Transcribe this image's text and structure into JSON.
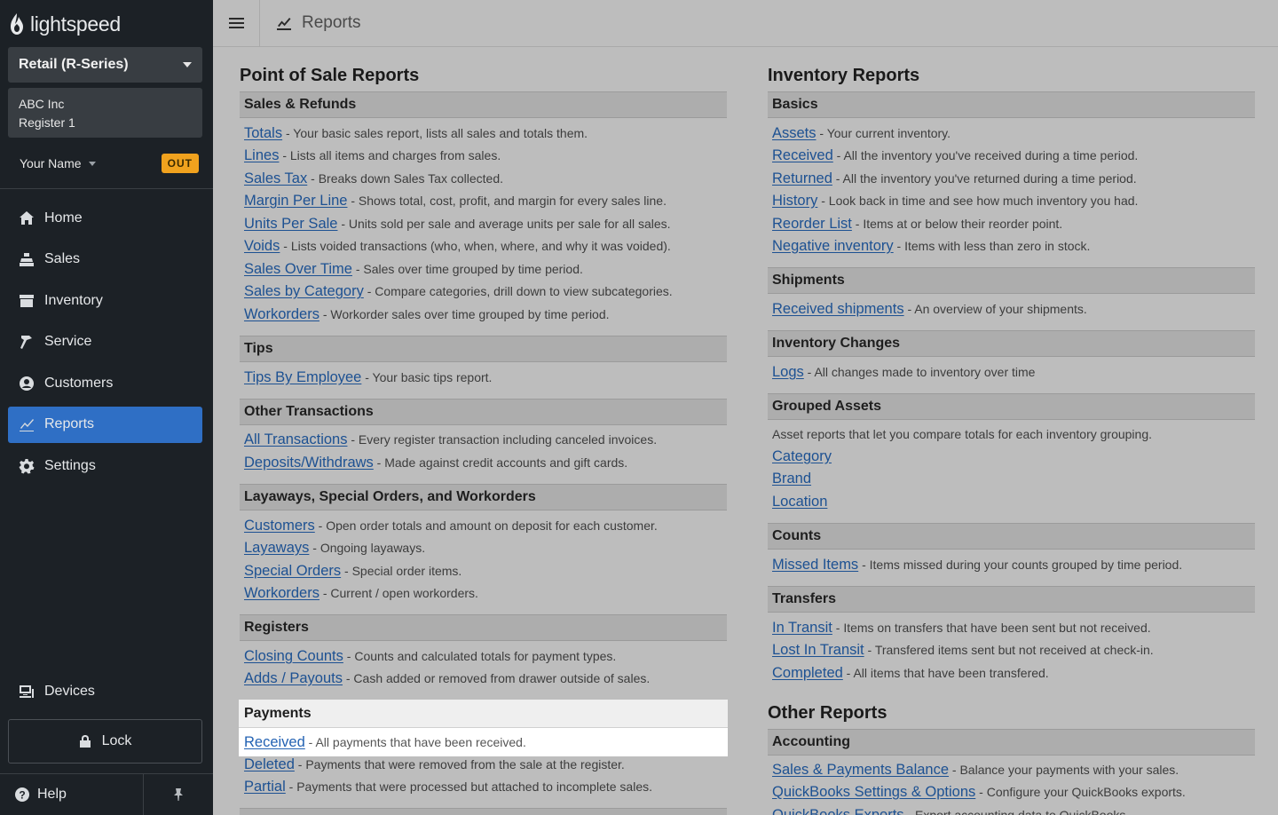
{
  "sidebar": {
    "logo_text": "lightspeed",
    "store": "Retail (R-Series)",
    "company": "ABC Inc",
    "register": "Register 1",
    "user_name": "Your Name",
    "out_badge": "OUT",
    "nav": [
      {
        "label": "Home",
        "icon": "home-icon"
      },
      {
        "label": "Sales",
        "icon": "sales-icon"
      },
      {
        "label": "Inventory",
        "icon": "inventory-icon"
      },
      {
        "label": "Service",
        "icon": "service-icon"
      },
      {
        "label": "Customers",
        "icon": "customers-icon"
      },
      {
        "label": "Reports",
        "icon": "reports-icon",
        "active": true
      },
      {
        "label": "Settings",
        "icon": "settings-icon"
      }
    ],
    "devices": "Devices",
    "lock": "Lock",
    "help": "Help"
  },
  "header": {
    "title": "Reports"
  },
  "pos": {
    "title": "Point of Sale Reports",
    "sales_refunds": {
      "heading": "Sales & Refunds",
      "items": [
        {
          "link": "Totals",
          "desc": " - Your basic sales report, lists all sales and totals them."
        },
        {
          "link": "Lines",
          "desc": " - Lists all items and charges from sales."
        },
        {
          "link": "Sales Tax",
          "desc": " - Breaks down Sales Tax collected."
        },
        {
          "link": "Margin Per Line",
          "desc": " - Shows total, cost, profit, and margin for every sales line."
        },
        {
          "link": "Units Per Sale",
          "desc": " - Units sold per sale and average units per sale for all sales."
        },
        {
          "link": "Voids",
          "desc": " - Lists voided transactions (who, when, where, and why it was voided)."
        },
        {
          "link": "Sales Over Time",
          "desc": " - Sales over time grouped by time period."
        },
        {
          "link": "Sales by Category",
          "desc": " - Compare categories, drill down to view subcategories."
        },
        {
          "link": "Workorders",
          "desc": " - Workorder sales over time grouped by time period."
        }
      ]
    },
    "tips": {
      "heading": "Tips",
      "items": [
        {
          "link": "Tips By Employee",
          "desc": " - Your basic tips report."
        }
      ]
    },
    "other": {
      "heading": "Other Transactions",
      "items": [
        {
          "link": "All Transactions",
          "desc": " - Every register transaction including canceled invoices."
        },
        {
          "link": "Deposits/Withdraws",
          "desc": " - Made against credit accounts and gift cards."
        }
      ]
    },
    "layaways": {
      "heading": "Layaways, Special Orders, and Workorders",
      "items": [
        {
          "link": "Customers",
          "desc": " - Open order totals and amount on deposit for each customer."
        },
        {
          "link": "Layaways",
          "desc": " - Ongoing layaways."
        },
        {
          "link": "Special Orders",
          "desc": " - Special order items."
        },
        {
          "link": "Workorders",
          "desc": " - Current / open workorders."
        }
      ]
    },
    "registers": {
      "heading": "Registers",
      "items": [
        {
          "link": "Closing Counts",
          "desc": " - Counts and calculated totals for payment types."
        },
        {
          "link": "Adds / Payouts",
          "desc": " - Cash added or removed from drawer outside of sales."
        }
      ]
    },
    "payments": {
      "heading": "Payments",
      "highlight": {
        "link": "Received",
        "desc": " - All payments that have been received."
      },
      "items": [
        {
          "link": "Deleted",
          "desc": " - Payments that were removed from the sale at the register."
        },
        {
          "link": "Partial",
          "desc": " - Payments that were processed but attached to incomplete sales."
        }
      ]
    }
  },
  "inventory": {
    "title": "Inventory Reports",
    "basics": {
      "heading": "Basics",
      "items": [
        {
          "link": "Assets",
          "desc": " - Your current inventory."
        },
        {
          "link": "Received",
          "desc": " - All the inventory you've received during a time period."
        },
        {
          "link": "Returned",
          "desc": " - All the inventory you've returned during a time period."
        },
        {
          "link": "History",
          "desc": " - Look back in time and see how much inventory you had."
        },
        {
          "link": "Reorder List",
          "desc": " - Items at or below their reorder point."
        },
        {
          "link": "Negative inventory",
          "desc": " - Items with less than zero in stock."
        }
      ]
    },
    "shipments": {
      "heading": "Shipments",
      "items": [
        {
          "link": "Received shipments",
          "desc": " - An overview of your shipments."
        }
      ]
    },
    "changes": {
      "heading": "Inventory Changes",
      "items": [
        {
          "link": "Logs",
          "desc": " - All changes made to inventory over time"
        }
      ]
    },
    "grouped": {
      "heading": "Grouped Assets",
      "note": "Asset reports that let you compare totals for each inventory grouping.",
      "items": [
        {
          "link": "Category",
          "desc": ""
        },
        {
          "link": "Brand",
          "desc": ""
        },
        {
          "link": "Location",
          "desc": ""
        }
      ]
    },
    "counts": {
      "heading": "Counts",
      "items": [
        {
          "link": "Missed Items",
          "desc": " - Items missed during your counts grouped by time period."
        }
      ]
    },
    "transfers": {
      "heading": "Transfers",
      "items": [
        {
          "link": "In Transit",
          "desc": " - Items on transfers that have been sent but not received."
        },
        {
          "link": "Lost In Transit",
          "desc": " - Transfered items sent but not received at check-in."
        },
        {
          "link": "Completed",
          "desc": " - All items that have been transfered."
        }
      ]
    }
  },
  "other_reports": {
    "title": "Other Reports",
    "accounting": {
      "heading": "Accounting",
      "items": [
        {
          "link": "Sales & Payments Balance",
          "desc": " - Balance your payments with your sales."
        },
        {
          "link": "QuickBooks Settings & Options",
          "desc": " - Configure your QuickBooks exports."
        },
        {
          "link": "QuickBooks Exports",
          "desc": " - Export accounting data to QuickBooks."
        }
      ]
    }
  }
}
